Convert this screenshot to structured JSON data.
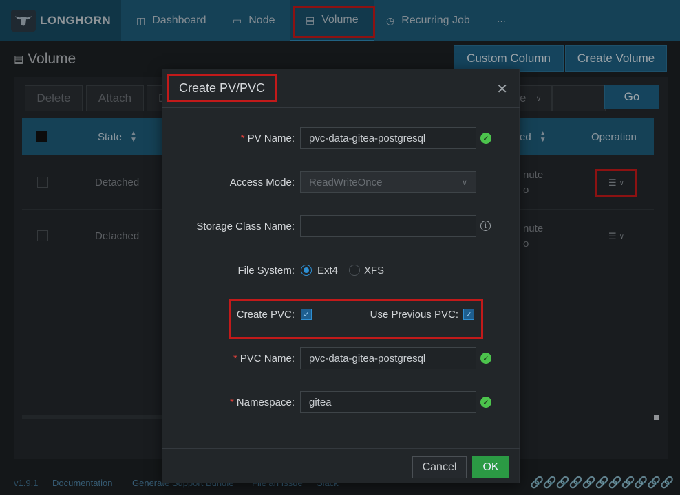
{
  "app": {
    "brand": "LONGHORN"
  },
  "nav": [
    {
      "label": "Dashboard",
      "icon": "dashboard-icon"
    },
    {
      "label": "Node",
      "icon": "monitor-icon"
    },
    {
      "label": "Volume",
      "icon": "volume-icon"
    },
    {
      "label": "Recurring Job",
      "icon": "clock-icon"
    },
    {
      "label": "···",
      "icon": "more-icon"
    }
  ],
  "page": {
    "title": "Volume",
    "custom_column": "Custom Column",
    "create_volume": "Create Volume"
  },
  "toolbar": {
    "delete": "Delete",
    "attach": "Attach",
    "detach_partial": "D",
    "filter_partial": "e",
    "go": "Go"
  },
  "table": {
    "headers": {
      "state": "State",
      "created_partial": "ed",
      "operation": "Operation"
    },
    "rows": [
      {
        "state": "Detached",
        "created_l1": "nute",
        "created_l2": "o"
      },
      {
        "state": "Detached",
        "created_l1": "nute",
        "created_l2": "o"
      }
    ]
  },
  "footer": {
    "version": "v1.9.1",
    "documentation": "Documentation",
    "support_bundle": "Generate Support Bundle",
    "file_issue": "File an Issue",
    "slack": "Slack"
  },
  "modal": {
    "title": "Create PV/PVC",
    "pv_name_label": "PV Name",
    "pv_name_value": "pvc-data-gitea-postgresql",
    "access_mode_label": "Access Mode",
    "access_mode_value": "ReadWriteOnce",
    "storage_class_label": "Storage Class Name",
    "storage_class_value": "",
    "file_system_label": "File System",
    "fs_option_1": "Ext4",
    "fs_option_2": "XFS",
    "fs_selected": "Ext4",
    "create_pvc_label": "Create PVC",
    "create_pvc_checked": true,
    "use_previous_pvc_label": "Use Previous PVC",
    "use_previous_pvc_checked": true,
    "pvc_name_label": "PVC Name",
    "pvc_name_value": "pvc-data-gitea-postgresql",
    "namespace_label": "Namespace",
    "namespace_value": "gitea",
    "cancel": "Cancel",
    "ok": "OK"
  },
  "colors": {
    "accent": "#1e5a78",
    "ok_button": "#2b9a44",
    "required": "#e0403a",
    "valid": "#4cc34c",
    "highlight": "#c21a1a"
  }
}
